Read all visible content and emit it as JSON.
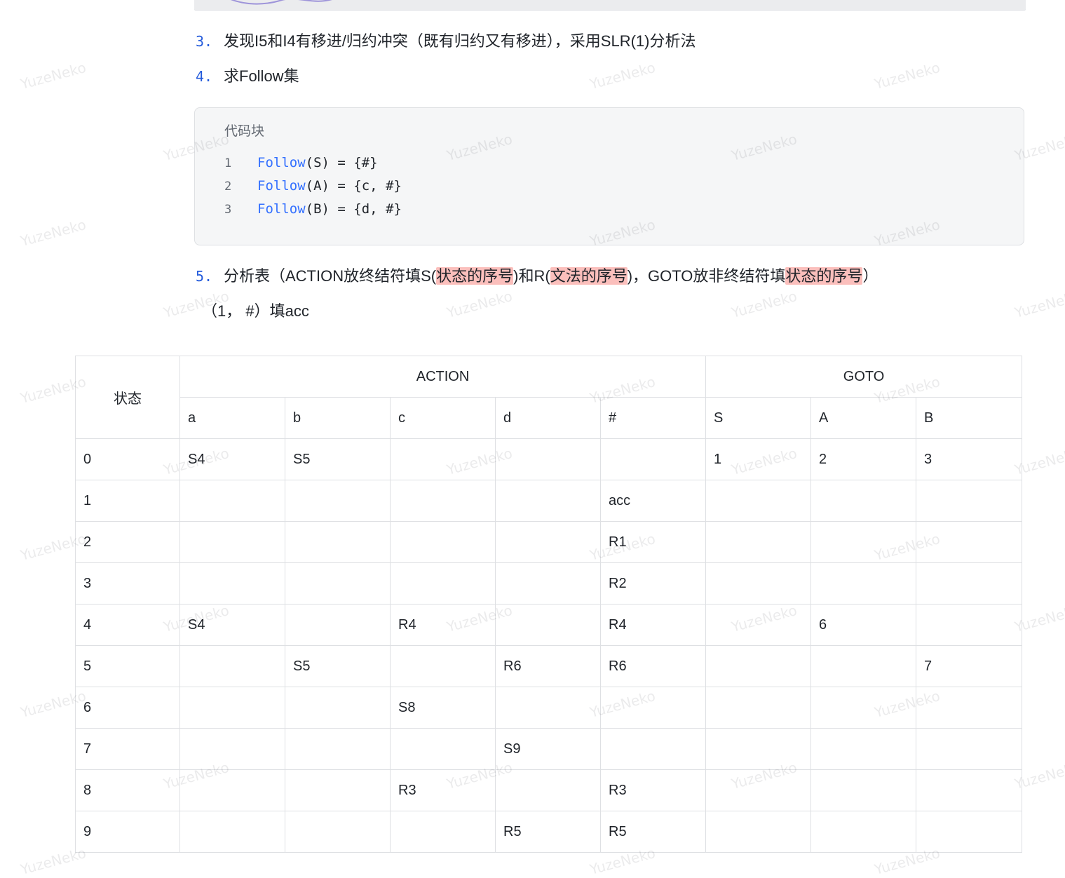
{
  "list": [
    {
      "num": "3.",
      "parts": [
        {
          "text": "发现I5和I4有移进/归约冲突（既有归约又有移进），采用SLR(1)分析法"
        }
      ]
    },
    {
      "num": "4.",
      "parts": [
        {
          "text": "求Follow集"
        }
      ]
    },
    {
      "num": "5.",
      "parts": [
        {
          "text": "分析表（ACTION放终结符填S("
        },
        {
          "text": "状态的序号",
          "hl": true
        },
        {
          "text": ")和R("
        },
        {
          "text": "文法的序号",
          "hl": true
        },
        {
          "text": ")，GOTO放非终结符填"
        },
        {
          "text": "状态的序号",
          "hl": true
        },
        {
          "text": "）"
        }
      ]
    }
  ],
  "code_block": {
    "title": "代码块",
    "lines": [
      {
        "num": "1",
        "fn": "Follow",
        "rest": "(S) = {#}"
      },
      {
        "num": "2",
        "fn": "Follow",
        "rest": "(A) = {c, #}"
      },
      {
        "num": "3",
        "fn": "Follow",
        "rest": "(B) = {d, #}"
      }
    ]
  },
  "note": "（1，  #）填acc",
  "table": {
    "state_header": "状态",
    "action_header": "ACTION",
    "goto_header": "GOTO",
    "columns": [
      "a",
      "b",
      "c",
      "d",
      "#",
      "S",
      "A",
      "B"
    ],
    "rows": [
      [
        "0",
        "S4",
        "S5",
        "",
        "",
        "",
        "1",
        "2",
        "3"
      ],
      [
        "1",
        "",
        "",
        "",
        "",
        "acc",
        "",
        "",
        ""
      ],
      [
        "2",
        "",
        "",
        "",
        "",
        "R1",
        "",
        "",
        ""
      ],
      [
        "3",
        "",
        "",
        "",
        "",
        "R2",
        "",
        "",
        ""
      ],
      [
        "4",
        "S4",
        "",
        "R4",
        "",
        "R4",
        "",
        "6",
        ""
      ],
      [
        "5",
        "",
        "S5",
        "",
        "R6",
        "R6",
        "",
        "",
        "7"
      ],
      [
        "6",
        "",
        "",
        "S8",
        "",
        "",
        "",
        "",
        ""
      ],
      [
        "7",
        "",
        "",
        "",
        "S9",
        "",
        "",
        "",
        ""
      ],
      [
        "8",
        "",
        "",
        "R3",
        "",
        "R3",
        "",
        "",
        ""
      ],
      [
        "9",
        "",
        "",
        "",
        "R5",
        "R5",
        "",
        "",
        ""
      ]
    ]
  },
  "watermark": "YuzeNeko",
  "colors": {
    "list_number": "#245bdb",
    "code_function": "#3370ff",
    "highlight": "#fbbfbc",
    "border": "#dee0e3"
  }
}
